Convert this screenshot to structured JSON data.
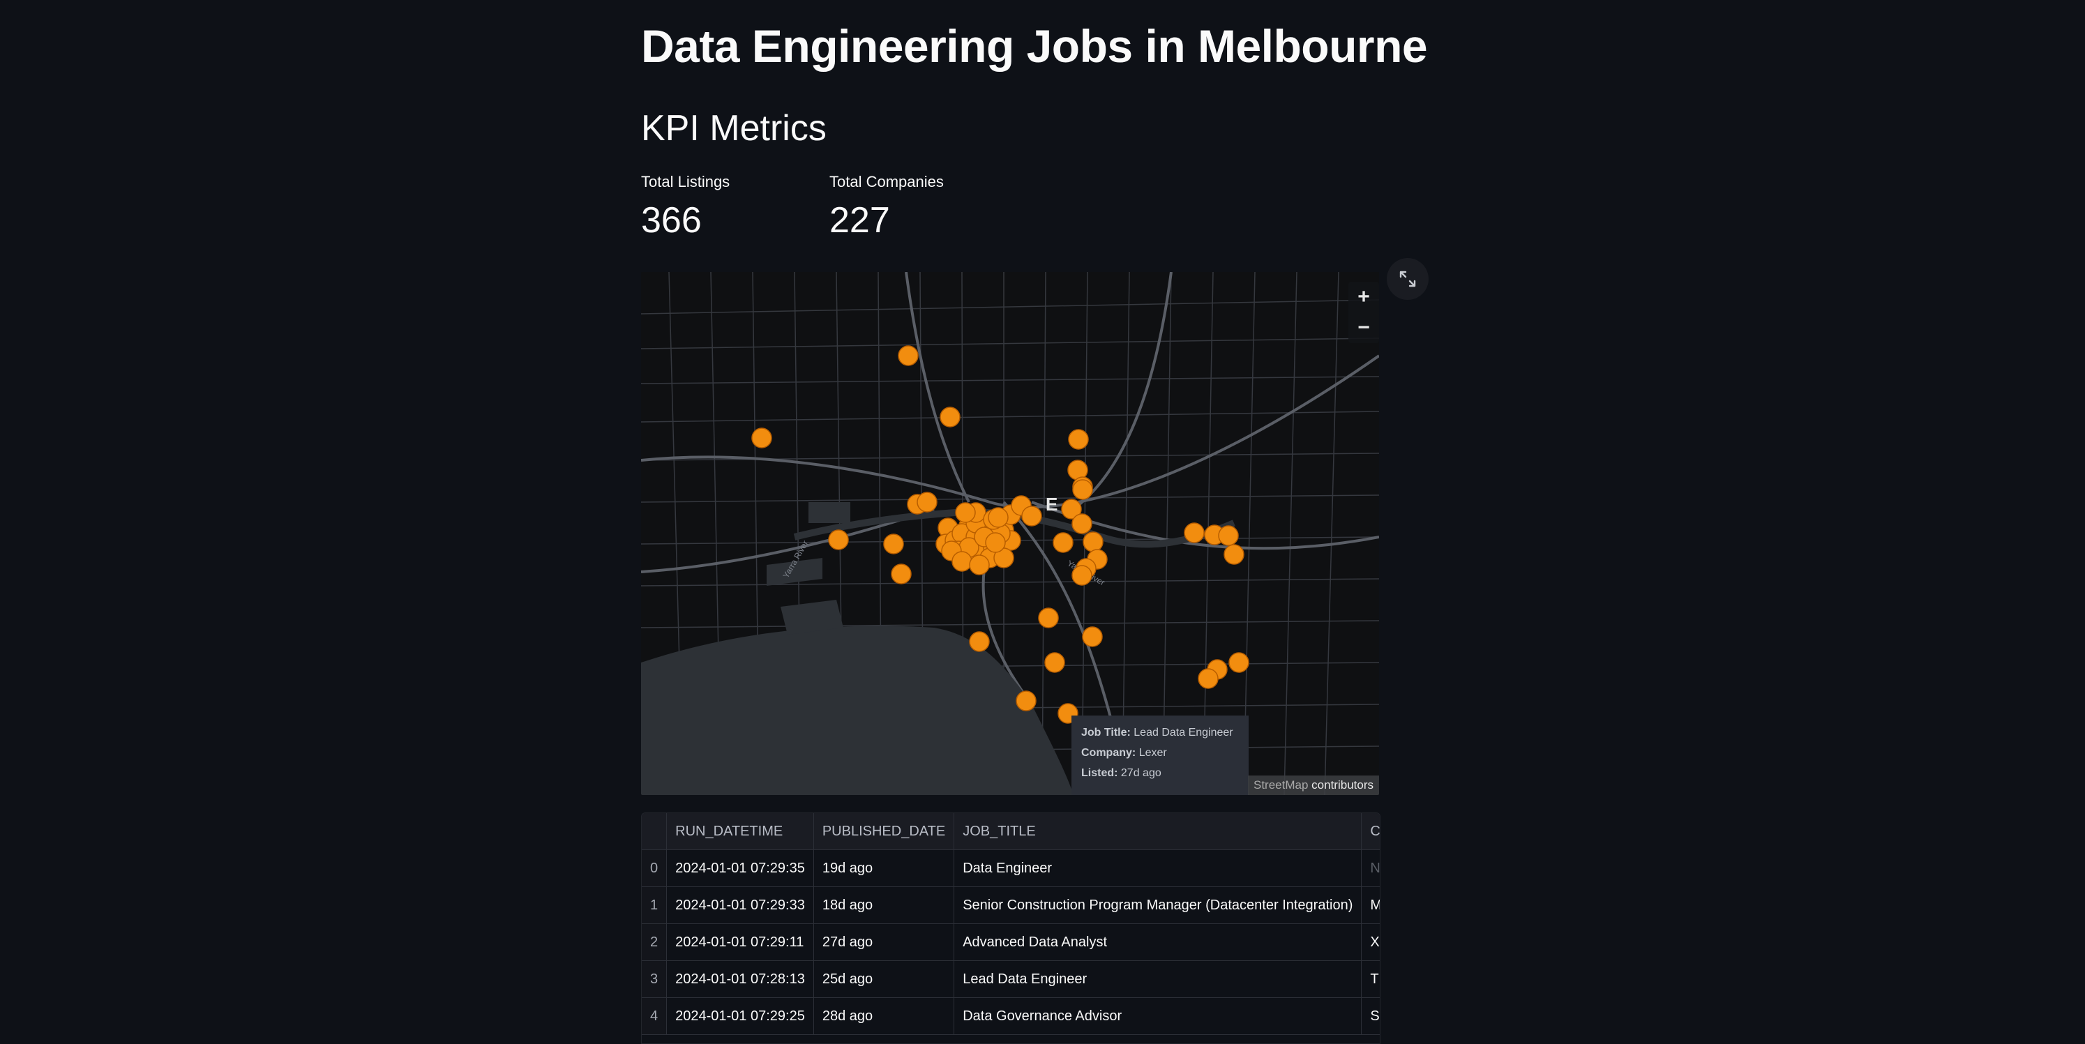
{
  "page": {
    "title": "Data Engineering Jobs in Melbourne",
    "subheader": "KPI Metrics"
  },
  "metrics": [
    {
      "label": "Total Listings",
      "value": "366"
    },
    {
      "label": "Total Companies",
      "value": "227"
    }
  ],
  "map": {
    "zoom_in": "+",
    "zoom_out": "−",
    "suburb_label": "E",
    "river_label_1": "Yarra River",
    "river_label_2": "Yarra River",
    "attribution_dim": "StreetMap",
    "attribution": "contributors",
    "marker_color": "#f28d0f",
    "tooltip": {
      "job_title_label": "Job Title:",
      "job_title": "Lead Data Engineer",
      "company_label": "Company:",
      "company": "Lexer",
      "listed_label": "Listed:",
      "listed": "27d ago"
    }
  },
  "table": {
    "columns": [
      "",
      "RUN_DATETIME",
      "PUBLISHED_DATE",
      "JOB_TITLE",
      "C"
    ],
    "rows": [
      {
        "index": "0",
        "run_datetime": "2024-01-01 07:29:35",
        "published_date": "19d ago",
        "job_title": "Data Engineer",
        "company": "N"
      },
      {
        "index": "1",
        "run_datetime": "2024-01-01 07:29:33",
        "published_date": "18d ago",
        "job_title": "Senior Construction Program Manager (Datacenter Integration)",
        "company": "M"
      },
      {
        "index": "2",
        "run_datetime": "2024-01-01 07:29:11",
        "published_date": "27d ago",
        "job_title": "Advanced Data Analyst",
        "company": "X"
      },
      {
        "index": "3",
        "run_datetime": "2024-01-01 07:28:13",
        "published_date": "25d ago",
        "job_title": "Lead Data Engineer",
        "company": "T"
      },
      {
        "index": "4",
        "run_datetime": "2024-01-01 07:29:25",
        "published_date": "28d ago",
        "job_title": "Data Governance Advisor",
        "company": "S"
      }
    ]
  }
}
